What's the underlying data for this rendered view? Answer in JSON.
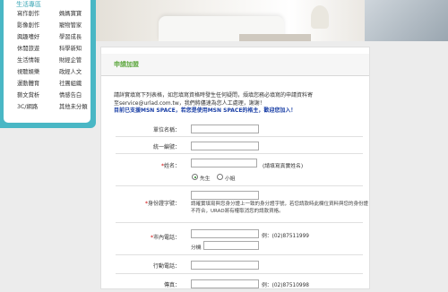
{
  "menu": {
    "title": "生活專區",
    "rows": [
      {
        "left": "寫作創作",
        "right": "媽媽寶寶"
      },
      {
        "left": "影像創作",
        "right": "寵物管家"
      },
      {
        "left": "興趣嗜好",
        "right": "學習成長"
      },
      {
        "left": "休閒旅遊",
        "right": "科學新知"
      },
      {
        "left": "生活情報",
        "right": "財經企管"
      },
      {
        "left": "視聽娛樂",
        "right": "政經人文"
      },
      {
        "left": "運動體育",
        "right": "社團組織"
      },
      {
        "left": "藝文賞析",
        "right": "情感告白"
      },
      {
        "left": "3C/網路",
        "right": "其他未分類"
      }
    ]
  },
  "form": {
    "title": "申請加盟",
    "intro_line1": "請詳實填寫下列表格，如您填寫資格時發生任何疑問，煩填您務必填寫的申請資料寄",
    "intro_line2": "至service@urlad.com.tw，我們將儘速為您人工處理，謝謝！",
    "intro_line3": "目前已支援MSN SPACE，若您是使用MSN SPACE的格主，歡迎您加入！",
    "fields": {
      "unit_name_label": "單位名稱：",
      "tax_id_label": "統一編號：",
      "name_label": "姓名：",
      "name_hint": "(請填寫真實姓名)",
      "gender_male": "先生",
      "gender_female": "小姐",
      "id_label": "身份證字號：",
      "id_note": "請確實填寫與您身分證上一致的身分證字號，若您請款時此欄位資料與您的身份證不符合，URAD將有權取消您的請款資格。",
      "phone_label": "市內電話：",
      "phone_example": "例：(02)87511999",
      "ext_label": "分機",
      "mobile_label": "行動電話：",
      "fax_label": "傳真：",
      "fax_example": "例：(02)87510998"
    }
  }
}
